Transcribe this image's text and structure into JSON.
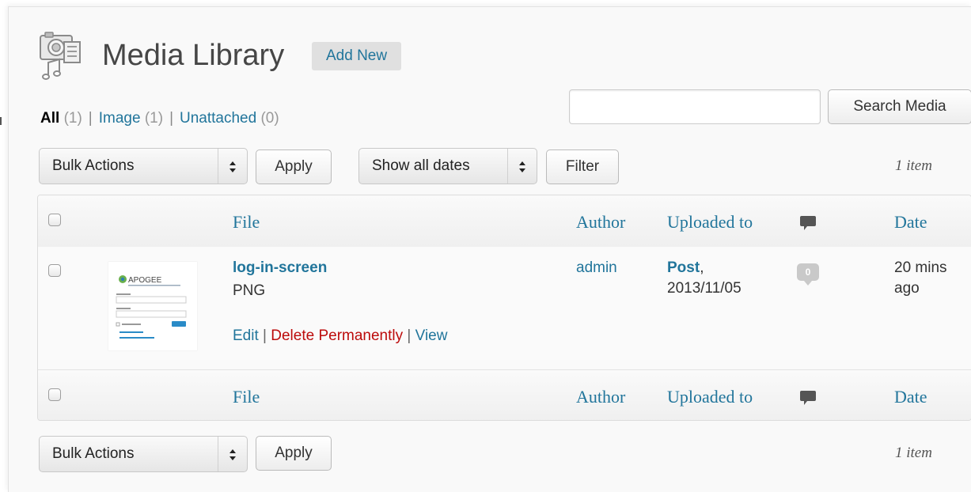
{
  "header": {
    "title": "Media Library",
    "add_new": "Add New"
  },
  "filters": {
    "all_label": "All",
    "all_count": "(1)",
    "image_label": "Image",
    "image_count": "(1)",
    "unattached_label": "Unattached",
    "unattached_count": "(0)",
    "separator": "|"
  },
  "search": {
    "value": "",
    "button": "Search Media"
  },
  "toolbar_top": {
    "bulk_actions": "Bulk Actions",
    "apply": "Apply",
    "dates": "Show all dates",
    "filter": "Filter",
    "items": "1 item"
  },
  "toolbar_bottom": {
    "bulk_actions": "Bulk Actions",
    "apply": "Apply",
    "items": "1 item"
  },
  "table": {
    "columns": {
      "file": "File",
      "author": "Author",
      "uploaded_to": "Uploaded to",
      "date": "Date"
    },
    "rows": [
      {
        "file_name": "log-in-screen",
        "file_type": "PNG",
        "actions": {
          "edit": "Edit",
          "delete": "Delete Permanently",
          "view": "View",
          "separator": "|"
        },
        "author": "admin",
        "uploaded_post": "Post",
        "uploaded_date": "2013/11/05",
        "comments": "0",
        "date": "20 mins ago"
      }
    ]
  },
  "thumbnail": {
    "logo_text": "APOGEE"
  },
  "colors": {
    "link": "#21759b",
    "delete": "#bc0b0b",
    "title": "#464646"
  }
}
